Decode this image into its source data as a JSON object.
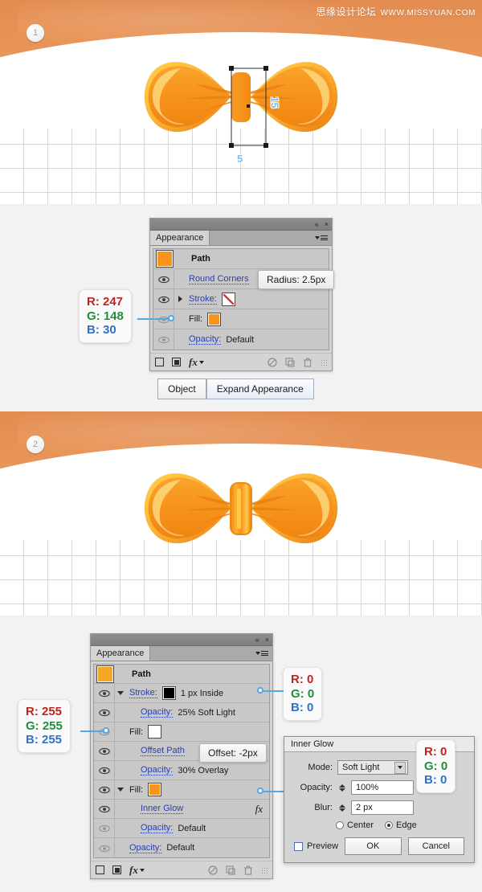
{
  "watermark": {
    "cn": "思缘设计论坛",
    "url": "WWW.MISSYUAN.COM"
  },
  "steps": {
    "one": "1",
    "two": "2"
  },
  "canvas1": {
    "dim_height": "15",
    "dim_width": "5"
  },
  "panel1": {
    "tab_label": "Appearance",
    "collapse_icon": "«",
    "close_icon": "×",
    "menu_icon": "panel-menu-icon",
    "target_label": "Path",
    "target_swatch": "#F79420",
    "rows": [
      {
        "name": "round-corners",
        "label": "Round Corners",
        "link": true,
        "visible": true
      },
      {
        "name": "stroke",
        "label": "Stroke:",
        "link": true,
        "visible": true,
        "swatch": "none"
      },
      {
        "name": "fill",
        "label": "Fill:",
        "link": false,
        "visible": false,
        "swatch": "#F79420"
      },
      {
        "name": "opacity",
        "label": "Opacity:",
        "link": true,
        "visible": false,
        "value": "Default"
      }
    ],
    "tooltip": "Radius: 2.5px",
    "rgb_callout": {
      "r": "R: 247",
      "g": "G: 148",
      "b": "B: 30"
    }
  },
  "buttons": {
    "object": "Object",
    "expand_appearance": "Expand Appearance"
  },
  "panel2": {
    "tab_label": "Appearance",
    "collapse_icon": "«",
    "close_icon": "×",
    "target_label": "Path",
    "target_swatch": "#F5A623",
    "rows": [
      {
        "name": "stroke",
        "label": "Stroke:",
        "link": true,
        "visible": true,
        "swatch": "#000000",
        "extra": "1 px  Inside"
      },
      {
        "name": "stroke-opacity",
        "label": "Opacity:",
        "link": true,
        "visible": true,
        "value": "25% Soft Light"
      },
      {
        "name": "fill-white",
        "label": "Fill:",
        "link": false,
        "visible": false,
        "swatch": "#FFFFFF"
      },
      {
        "name": "offset-path",
        "label": "Offset Path",
        "link": true,
        "visible": true
      },
      {
        "name": "offset-opacity",
        "label": "Opacity:",
        "link": true,
        "visible": true,
        "value": "30% Overlay"
      },
      {
        "name": "fill-orange",
        "label": "Fill:",
        "link": false,
        "visible": true,
        "swatch": "#F7941E"
      },
      {
        "name": "inner-glow",
        "label": "Inner Glow",
        "link": true,
        "visible": true,
        "fx": "fx"
      },
      {
        "name": "inner-glow-opacity",
        "label": "Opacity:",
        "link": true,
        "visible": false,
        "value": "Default"
      },
      {
        "name": "object-opacity",
        "label": "Opacity:",
        "link": true,
        "visible": false,
        "value": "Default"
      }
    ],
    "tooltip": "Offset: -2px",
    "rgb_white": {
      "r": "R: 255",
      "g": "G: 255",
      "b": "B: 255"
    },
    "rgb_black": {
      "r": "R: 0",
      "g": "G: 0",
      "b": "B: 0"
    }
  },
  "dialog": {
    "title": "Inner Glow",
    "mode_label": "Mode:",
    "mode_value": "Soft Light",
    "mode_swatch": "#000000",
    "opacity_label": "Opacity:",
    "opacity_value": "100%",
    "blur_label": "Blur:",
    "blur_value": "2 px",
    "radio_center": "Center",
    "radio_edge": "Edge",
    "radio_selected": "Edge",
    "preview_label": "Preview",
    "ok": "OK",
    "cancel": "Cancel",
    "rgb_callout": {
      "r": "R: 0",
      "g": "G: 0",
      "b": "B: 0"
    }
  },
  "colors": {
    "band_orange": "#E89355",
    "bow_orange": "#F7941E",
    "bow_highlight": "#FDB813",
    "link_blue": "#2A3FA8",
    "dim_blue": "#77BFF3"
  }
}
